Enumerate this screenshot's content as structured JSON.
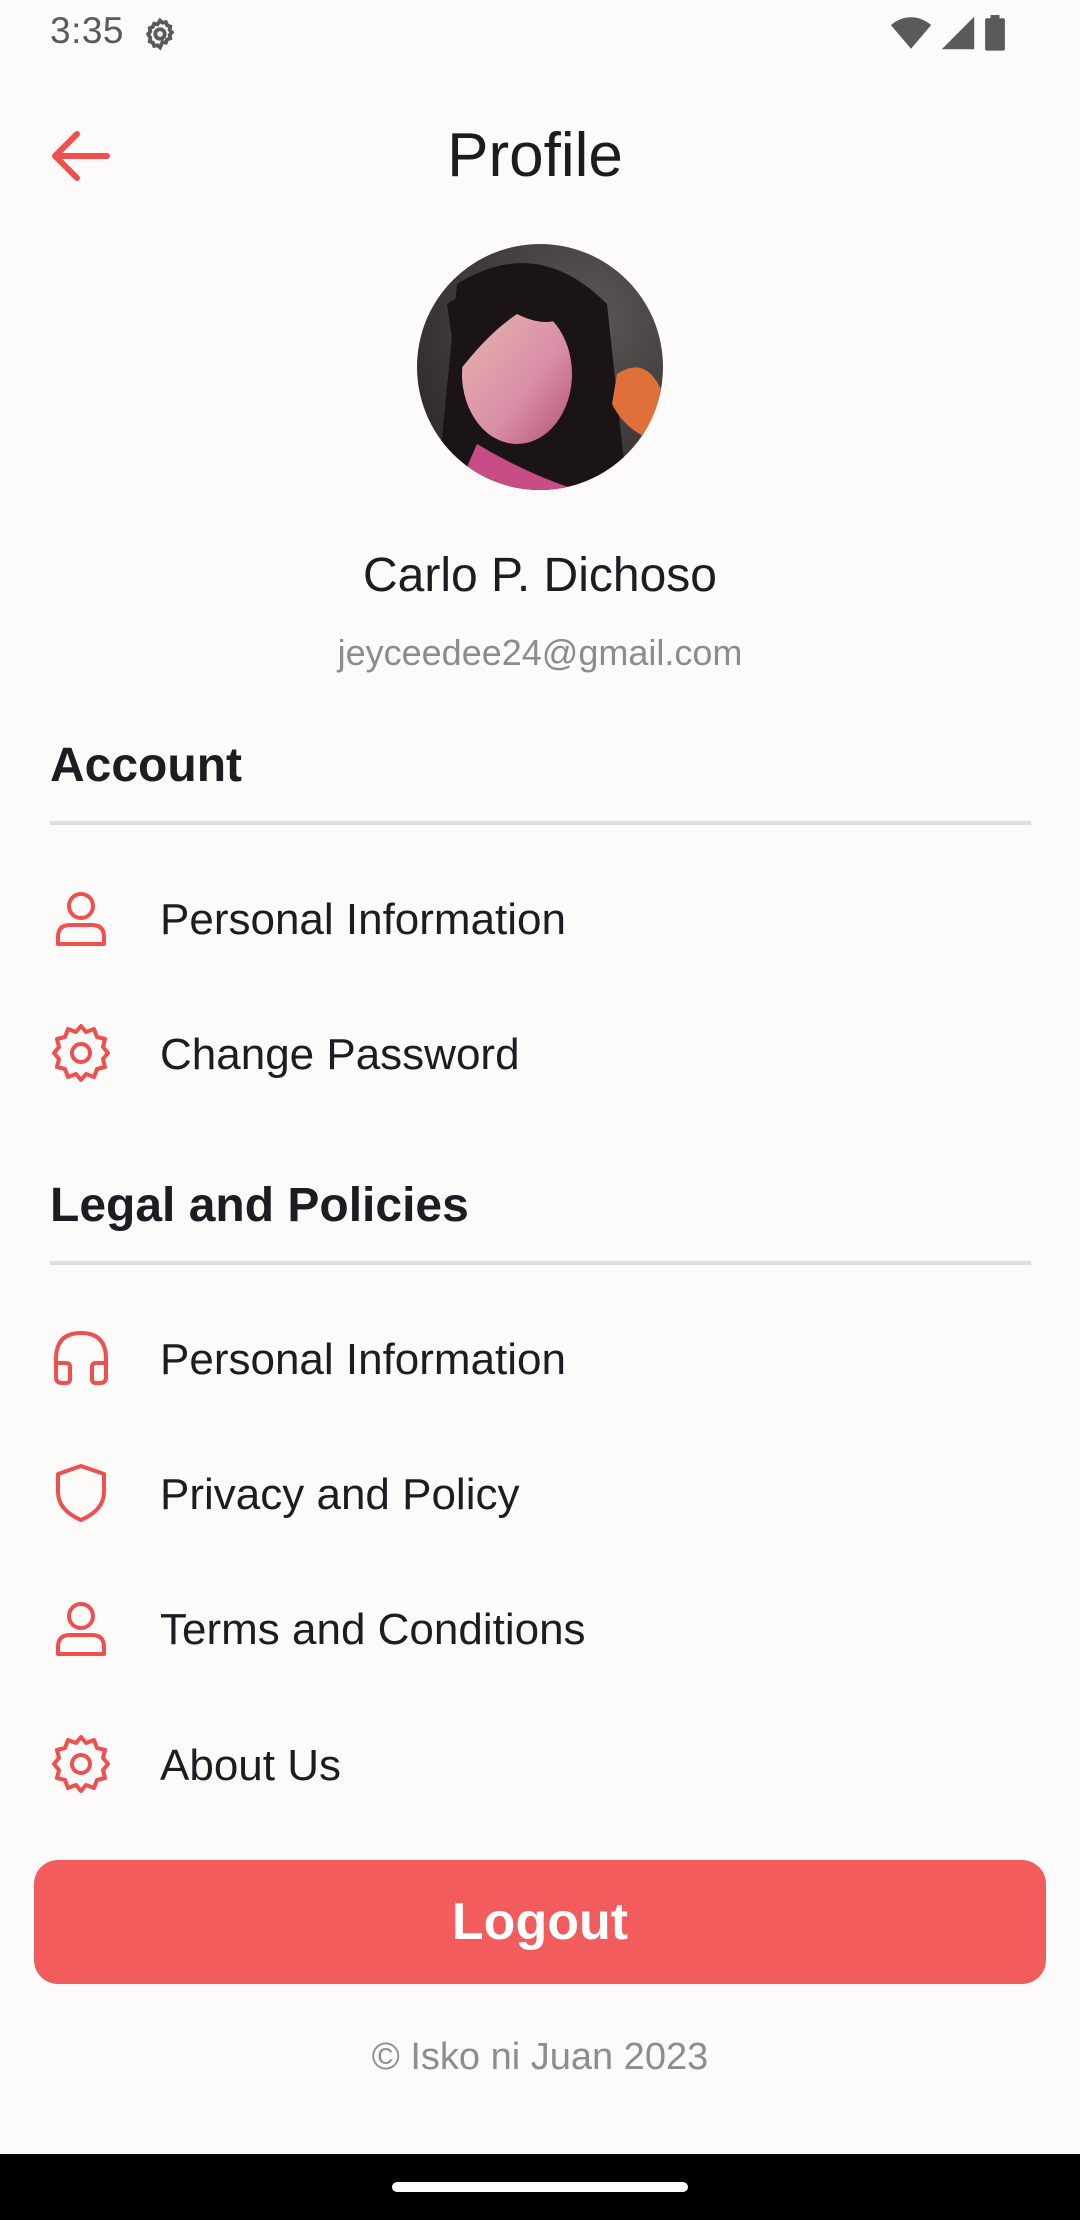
{
  "status_bar": {
    "time": "3:35",
    "icons": [
      "settings-icon",
      "wifi-icon",
      "signal-icon",
      "battery-icon"
    ]
  },
  "header": {
    "title": "Profile",
    "back_icon": "arrow-left-icon"
  },
  "profile": {
    "name": "Carlo P. Dichoso",
    "email": "jeyceedee24@gmail.com"
  },
  "sections": {
    "account": {
      "title": "Account",
      "items": [
        {
          "label": "Personal Information",
          "icon": "user-icon"
        },
        {
          "label": "Change Password",
          "icon": "gear-icon"
        }
      ]
    },
    "legal": {
      "title": "Legal and Policies",
      "items": [
        {
          "label": "Personal Information",
          "icon": "headphones-icon"
        },
        {
          "label": "Privacy and Policy",
          "icon": "shield-icon"
        },
        {
          "label": "Terms and Conditions",
          "icon": "user-icon"
        },
        {
          "label": "About Us",
          "icon": "gear-icon"
        }
      ]
    }
  },
  "logout": {
    "label": "Logout"
  },
  "footer": {
    "copyright": "© Isko ni Juan 2023"
  },
  "colors": {
    "accent": "#f25c5c",
    "background": "#fdfbfa",
    "text": "#1e1c22",
    "muted": "#8c8b90",
    "divider": "#dcdcdc"
  }
}
